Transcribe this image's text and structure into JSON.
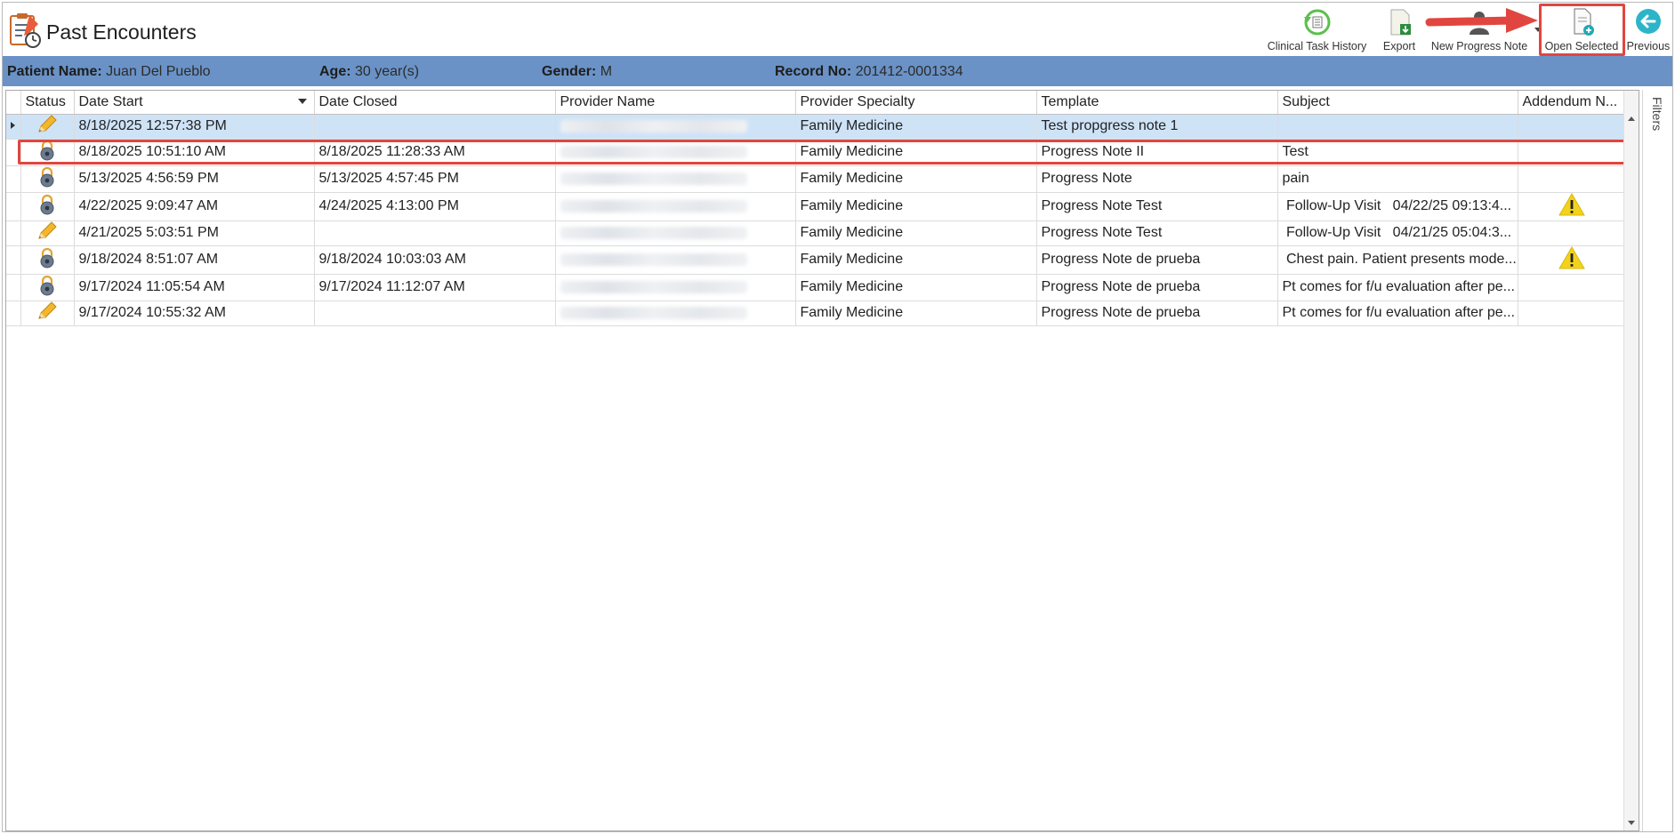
{
  "header": {
    "title": "Past Encounters"
  },
  "toolbar": {
    "clinical_task_history": "Clinical Task History",
    "export": "Export",
    "new_progress_note": "New Progress Note",
    "open_selected": "Open Selected",
    "previous": "Previous"
  },
  "patient": {
    "name_label": "Patient Name:",
    "name": "Juan Del Pueblo",
    "age_label": "Age:",
    "age": "30 year(s)",
    "gender_label": "Gender:",
    "gender": "M",
    "record_label": "Record No:",
    "record": "201412-0001334"
  },
  "grid": {
    "columns": [
      "Status",
      "Date Start",
      "Date Closed",
      "Provider Name",
      "Provider Specialty",
      "Template",
      "Subject",
      "Addendum N..."
    ],
    "rows": [
      {
        "status": "pencil-icon",
        "date_start": "8/18/2025 12:57:38 PM",
        "date_closed": "",
        "specialty": "Family Medicine",
        "template": "Test propgress note 1",
        "subject": "",
        "addendum": ""
      },
      {
        "status": "lock-icon",
        "date_start": "8/18/2025 10:51:10 AM",
        "date_closed": "8/18/2025 11:28:33 AM",
        "specialty": "Family Medicine",
        "template": "Progress Note II",
        "subject": "Test",
        "addendum": ""
      },
      {
        "status": "lock-icon",
        "date_start": "5/13/2025 4:56:59 PM",
        "date_closed": "5/13/2025 4:57:45 PM",
        "specialty": "Family Medicine",
        "template": "Progress Note",
        "subject": "pain",
        "addendum": ""
      },
      {
        "status": "lock-icon",
        "date_start": "4/22/2025 9:09:47 AM",
        "date_closed": "4/24/2025 4:13:00 PM",
        "specialty": "Family Medicine",
        "template": "Progress Note Test",
        "subject": " Follow-Up Visit   04/22/25 09:13:4...",
        "addendum": "warning-icon"
      },
      {
        "status": "pencil-icon",
        "date_start": "4/21/2025 5:03:51 PM",
        "date_closed": "",
        "specialty": "Family Medicine",
        "template": "Progress Note Test",
        "subject": " Follow-Up Visit   04/21/25 05:04:3...",
        "addendum": ""
      },
      {
        "status": "lock-icon",
        "date_start": "9/18/2024 8:51:07 AM",
        "date_closed": "9/18/2024 10:03:03 AM",
        "specialty": "Family Medicine",
        "template": "Progress Note de prueba",
        "subject": " Chest pain. Patient presents mode...",
        "addendum": "warning-icon"
      },
      {
        "status": "lock-icon",
        "date_start": "9/17/2024 11:05:54 AM",
        "date_closed": "9/17/2024 11:12:07 AM",
        "specialty": "Family Medicine",
        "template": "Progress Note de prueba",
        "subject": "Pt comes for f/u evaluation after pe...",
        "addendum": ""
      },
      {
        "status": "pencil-icon",
        "date_start": "9/17/2024 10:55:32 AM",
        "date_closed": "",
        "specialty": "Family Medicine",
        "template": "Progress Note de prueba",
        "subject": "Pt comes for f/u evaluation after pe...",
        "addendum": ""
      }
    ]
  },
  "side": {
    "filters": "Filters"
  },
  "colors": {
    "patient_bar": "#6a92c6",
    "selected_row": "#cfe3f7",
    "highlight": "#e0463f",
    "warning": "#f2d21a"
  }
}
